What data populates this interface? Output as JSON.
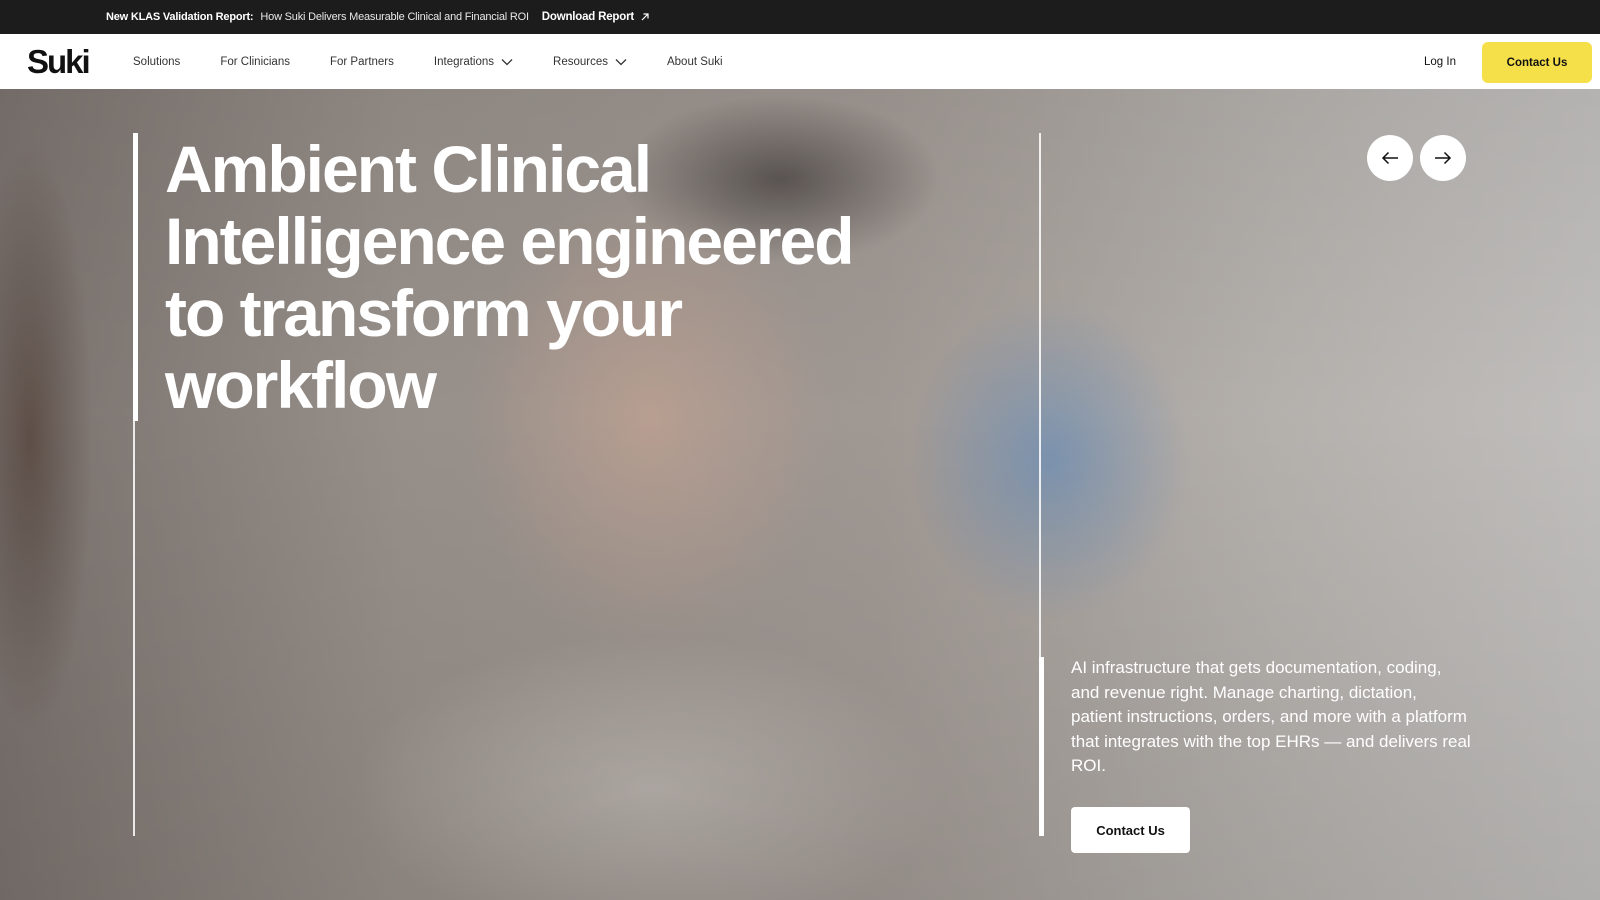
{
  "announcement": {
    "lead": "New KLAS Validation Report:",
    "text": "How Suki Delivers Measurable Clinical and Financial ROI",
    "link_label": "Download Report",
    "link_icon": "arrow-up-right-icon"
  },
  "nav": {
    "logo": "Suki",
    "items": [
      {
        "label": "Solutions"
      },
      {
        "label": "For Clinicians"
      },
      {
        "label": "For Partners"
      },
      {
        "label": "Integrations",
        "icon": "chevron-down-icon"
      },
      {
        "label": "Resources",
        "icon": "chevron-down-icon"
      },
      {
        "label": "About Suki"
      }
    ],
    "login_label": "Log In",
    "contact_label": "Contact Us"
  },
  "hero": {
    "headline": "Ambient Clinical Intelligence engineered to transform your workflow",
    "description": "AI infrastructure that gets documentation, coding, and revenue right. Manage charting, dictation, patient instructions, orders, and more with a platform that integrates with the top EHRs — and delivers real ROI.",
    "cta_label": "Contact Us",
    "prev_icon": "arrow-left-icon",
    "next_icon": "arrow-right-icon"
  },
  "colors": {
    "announcement_bg": "#1c1c1c",
    "accent_yellow": "#f6e04a",
    "text_dark": "#111111",
    "white": "#ffffff"
  }
}
